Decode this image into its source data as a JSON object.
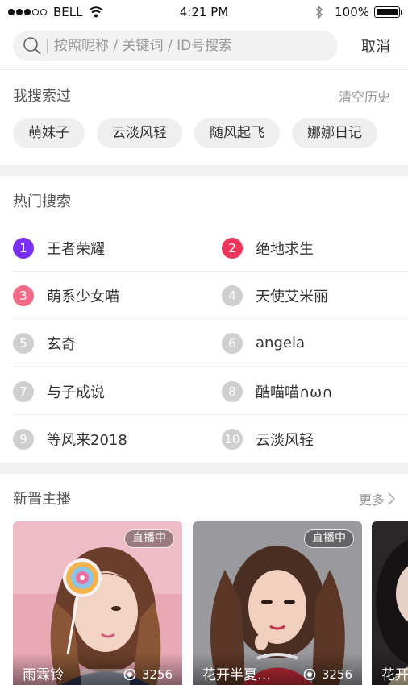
{
  "status_bar": {
    "carrier": "BELL",
    "time": "4:21 PM",
    "battery": "100%"
  },
  "search": {
    "placeholder": "按照昵称 / 关键词 / ID号搜索",
    "cancel_label": "取消"
  },
  "history": {
    "title": "我搜索过",
    "clear_label": "清空历史",
    "items": [
      "萌妹子",
      "云淡风轻",
      "随风起飞",
      "娜娜日记"
    ]
  },
  "hot": {
    "title": "热门搜索",
    "rank_colors": {
      "1": "#7b2ff2",
      "2": "#f0355d",
      "3": "#f26a86",
      "default": "#cfcfcf"
    },
    "items": [
      {
        "rank": "1",
        "text": "王者荣耀"
      },
      {
        "rank": "2",
        "text": "绝地求生"
      },
      {
        "rank": "3",
        "text": "萌系少女喵"
      },
      {
        "rank": "4",
        "text": "天使艾米丽"
      },
      {
        "rank": "5",
        "text": "玄奇"
      },
      {
        "rank": "6",
        "text": "angela"
      },
      {
        "rank": "7",
        "text": "与子成说"
      },
      {
        "rank": "8",
        "text": "酷喵喵∩ω∩"
      },
      {
        "rank": "9",
        "text": "等风来2018"
      },
      {
        "rank": "10",
        "text": "云淡风轻"
      }
    ]
  },
  "new_anchors": {
    "title": "新晋主播",
    "more_label": "更多",
    "cards": [
      {
        "name": "雨霖铃",
        "views": "3256",
        "badge": "直播中"
      },
      {
        "name": "花开半夏…",
        "views": "3256",
        "badge": "直播中"
      },
      {
        "name": "花开"
      }
    ]
  }
}
